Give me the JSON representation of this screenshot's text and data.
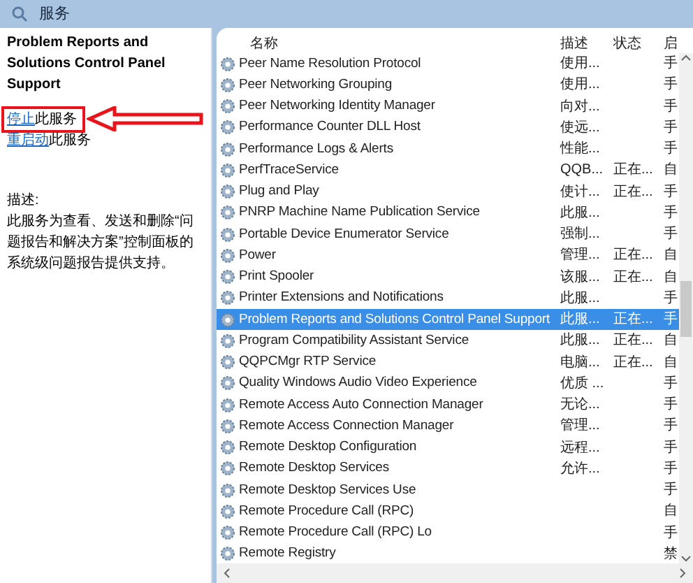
{
  "window": {
    "title": "服务"
  },
  "detail": {
    "title": "Problem Reports and Solutions Control Panel Support",
    "actions": [
      {
        "link": "停止",
        "text": "此服务",
        "highlighted": true
      },
      {
        "link": "重启动",
        "text": "此服务",
        "highlighted": false
      }
    ],
    "description_label": "描述:",
    "description": "此服务为查看、发送和删除“问题报告和解决方案”控制面板的系统级问题报告提供支持。"
  },
  "table": {
    "columns": [
      "名称",
      "描述",
      "状态",
      "启"
    ],
    "rows": [
      {
        "name": "Peer Name Resolution Protocol",
        "description": "使用...",
        "status": "",
        "startup": "手",
        "selected": false
      },
      {
        "name": "Peer Networking Grouping",
        "description": "使用...",
        "status": "",
        "startup": "手",
        "selected": false
      },
      {
        "name": "Peer Networking Identity Manager",
        "description": "向对...",
        "status": "",
        "startup": "手",
        "selected": false
      },
      {
        "name": "Performance Counter DLL Host",
        "description": "使远...",
        "status": "",
        "startup": "手",
        "selected": false
      },
      {
        "name": "Performance Logs & Alerts",
        "description": "性能...",
        "status": "",
        "startup": "手",
        "selected": false
      },
      {
        "name": "PerfTraceService",
        "description": "QQB...",
        "status": "正在...",
        "startup": "自",
        "selected": false
      },
      {
        "name": "Plug and Play",
        "description": "使计...",
        "status": "正在...",
        "startup": "手",
        "selected": false
      },
      {
        "name": "PNRP Machine Name Publication Service",
        "description": "此服...",
        "status": "",
        "startup": "手",
        "selected": false
      },
      {
        "name": "Portable Device Enumerator Service",
        "description": "强制...",
        "status": "",
        "startup": "手",
        "selected": false
      },
      {
        "name": "Power",
        "description": "管理...",
        "status": "正在...",
        "startup": "自",
        "selected": false
      },
      {
        "name": "Print Spooler",
        "description": "该服...",
        "status": "正在...",
        "startup": "自",
        "selected": false
      },
      {
        "name": "Printer Extensions and Notifications",
        "description": "此服...",
        "status": "",
        "startup": "手",
        "selected": false
      },
      {
        "name": "Problem Reports and Solutions Control Panel Support",
        "description": "此服...",
        "status": "正在...",
        "startup": "手",
        "selected": true
      },
      {
        "name": "Program Compatibility Assistant Service",
        "description": "此服...",
        "status": "正在...",
        "startup": "自",
        "selected": false
      },
      {
        "name": "QQPCMgr RTP Service",
        "description": "电脑...",
        "status": "正在...",
        "startup": "自",
        "selected": false
      },
      {
        "name": "Quality Windows Audio Video Experience",
        "description": "优质 ...",
        "status": "",
        "startup": "手",
        "selected": false
      },
      {
        "name": "Remote Access Auto Connection Manager",
        "description": "无论...",
        "status": "",
        "startup": "手",
        "selected": false
      },
      {
        "name": "Remote Access Connection Manager",
        "description": "管理...",
        "status": "",
        "startup": "手",
        "selected": false
      },
      {
        "name": "Remote Desktop Configuration",
        "description": "远程...",
        "status": "",
        "startup": "手",
        "selected": false
      },
      {
        "name": "Remote Desktop Services",
        "description": "允许...",
        "status": "",
        "startup": "手",
        "selected": false
      },
      {
        "name": "Remote Desktop Services Use",
        "description": "",
        "status": "",
        "startup": "手",
        "selected": false
      },
      {
        "name": "Remote Procedure Call (RPC)",
        "description": "",
        "status": "",
        "startup": "自",
        "selected": false
      },
      {
        "name": "Remote Procedure Call (RPC) Lo",
        "description": "",
        "status": "",
        "startup": "手",
        "selected": false
      },
      {
        "name": "Remote Registry",
        "description": "",
        "status": "",
        "startup": "禁",
        "selected": false
      }
    ]
  }
}
